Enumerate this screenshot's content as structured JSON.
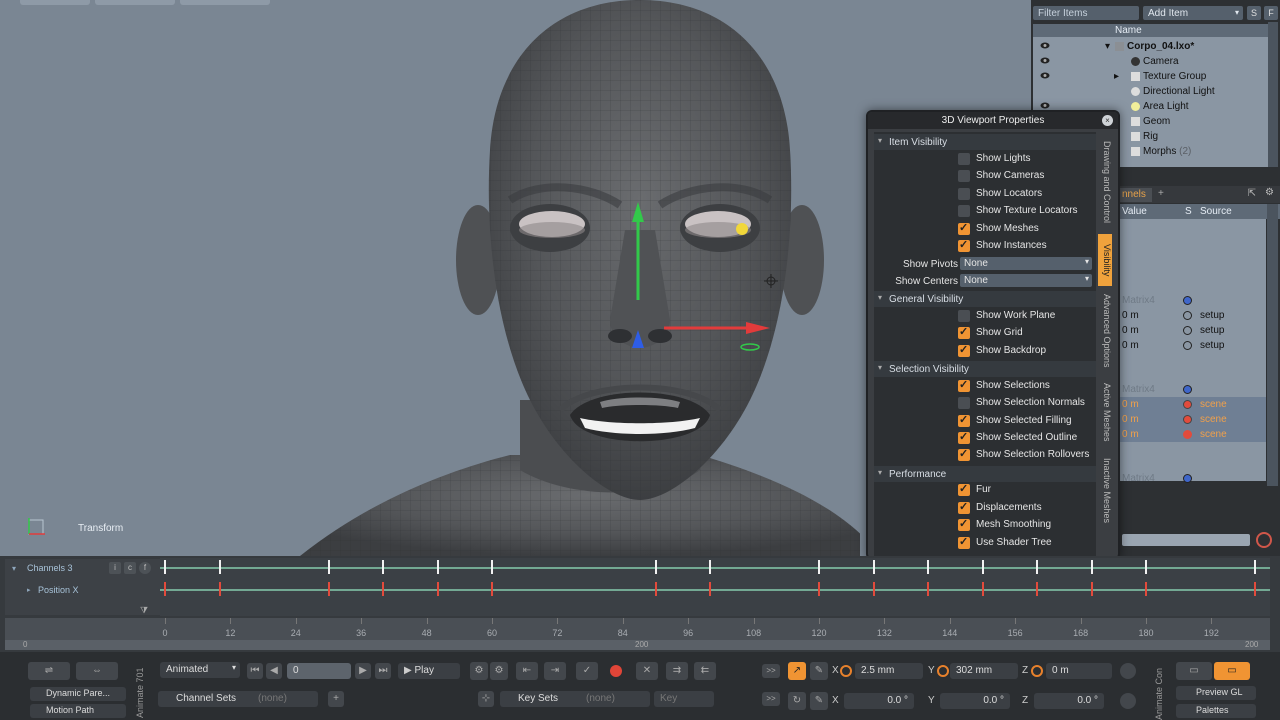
{
  "viewport": {
    "label": "Transform"
  },
  "items": {
    "filter_placeholder": "Filter Items",
    "add_item": "Add Item",
    "s_btn": "S",
    "f_btn": "F",
    "col_name": "Name",
    "rows": [
      {
        "label": "Corpo_04.lxo*",
        "count": ""
      },
      {
        "label": "Camera",
        "count": ""
      },
      {
        "label": "Texture Group",
        "count": ""
      },
      {
        "label": "Directional Light",
        "count": ""
      },
      {
        "label": "Area Light",
        "count": ""
      },
      {
        "label": "Geom",
        "count": ""
      },
      {
        "label": "Rig",
        "count": ""
      },
      {
        "label": "Morphs",
        "count": "(2)"
      }
    ]
  },
  "channels": {
    "tab": "nnels",
    "add": "+",
    "col_value": "Value",
    "col_s": "S",
    "col_source": "Source",
    "rows": [
      {
        "value": "Matrix4",
        "source": ""
      },
      {
        "value": "0 m",
        "source": "setup"
      },
      {
        "value": "0 m",
        "source": "setup"
      },
      {
        "value": "0 m",
        "source": "setup"
      },
      {
        "value": "Matrix4",
        "source": ""
      },
      {
        "value": "0 m",
        "source": "scene"
      },
      {
        "value": "0 m",
        "source": "scene"
      },
      {
        "value": "0 m",
        "source": "scene"
      },
      {
        "value": "Matrix4",
        "source": ""
      }
    ]
  },
  "props": {
    "title": "3D Viewport Properties",
    "close": "×",
    "tabs": [
      "Drawing and Control",
      "Visibility",
      "Advanced Options",
      "Active Meshes",
      "Inactive Meshes"
    ],
    "sections": {
      "item_visibility": "Item Visibility",
      "general_visibility": "General Visibility",
      "selection_visibility": "Selection Visibility",
      "performance": "Performance"
    },
    "item_options": [
      {
        "label": "Show Lights",
        "checked": false
      },
      {
        "label": "Show Cameras",
        "checked": false
      },
      {
        "label": "Show Locators",
        "checked": false
      },
      {
        "label": "Show Texture Locators",
        "checked": false
      },
      {
        "label": "Show Meshes",
        "checked": true
      },
      {
        "label": "Show Instances",
        "checked": true
      }
    ],
    "show_pivots_label": "Show Pivots",
    "show_pivots_value": "None",
    "show_centers_label": "Show Centers",
    "show_centers_value": "None",
    "general_options": [
      {
        "label": "Show Work Plane",
        "checked": false
      },
      {
        "label": "Show Grid",
        "checked": true
      },
      {
        "label": "Show Backdrop",
        "checked": true
      }
    ],
    "selection_options": [
      {
        "label": "Show Selections",
        "checked": true
      },
      {
        "label": "Show Selection Normals",
        "checked": false
      },
      {
        "label": "Show Selected Filling",
        "checked": true
      },
      {
        "label": "Show Selected Outline",
        "checked": true
      },
      {
        "label": "Show Selection Rollovers",
        "checked": true
      }
    ],
    "performance_options": [
      {
        "label": "Fur",
        "checked": true
      },
      {
        "label": "Displacements",
        "checked": true
      },
      {
        "label": "Mesh Smoothing",
        "checked": true
      },
      {
        "label": "Use Shader Tree",
        "checked": true
      }
    ]
  },
  "timeline": {
    "channel_label": "Channels 3",
    "i_btn": "i",
    "c_btn": "c",
    "f_btn": "f",
    "position_label": "Position X",
    "ruler_numbers": [
      "0",
      "12",
      "24",
      "36",
      "48",
      "60",
      "72",
      "84",
      "96",
      "108",
      "120",
      "132",
      "144",
      "156",
      "168",
      "180",
      "192"
    ],
    "bar_numbers": [
      "0",
      "200",
      "200"
    ],
    "key_frames": [
      0,
      10,
      30,
      40,
      50,
      60,
      90,
      100,
      120,
      130,
      140,
      150,
      160,
      170,
      180,
      200
    ]
  },
  "toolbar": {
    "animate_tab": "Animate 701",
    "animated": "Animated",
    "frame": "0",
    "play": "Play",
    "dynamic_parent": "Dynamic Pare...",
    "motion_path": "Motion Path",
    "channel_sets": "Channel Sets",
    "none1": "(none)",
    "key_sets": "Key Sets",
    "none2": "(none)",
    "key": "Key",
    "x_label": "X",
    "y_label": "Y",
    "z_label": "Z",
    "x_pos": "2.5 mm",
    "y_pos": "302 mm",
    "z_pos": "0 m",
    "x_rot": "0.0 °",
    "y_rot": "0.0 °",
    "z_rot": "0.0 °",
    "animate_con": "Animate Con",
    "preview_gl": "Preview GL",
    "palettes": "Palettes",
    "arrows": ">>"
  },
  "colors": {
    "accent": "#f09433",
    "viewport_bg": "#7a8693",
    "key_line": "#73a993",
    "key_red": "#e24b3c"
  }
}
